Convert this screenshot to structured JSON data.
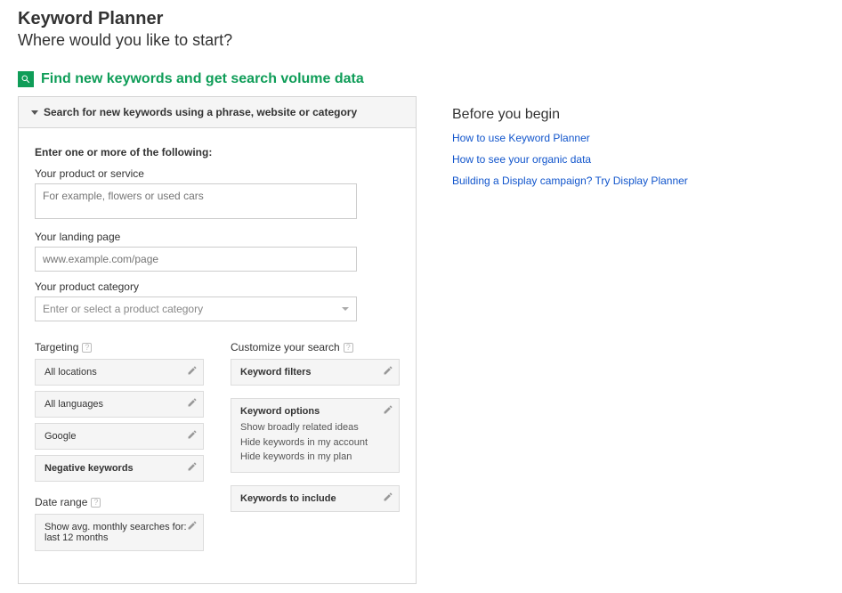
{
  "header": {
    "title": "Keyword Planner",
    "subtitle": "Where would you like to start?"
  },
  "section": {
    "title": "Find new keywords and get search volume data",
    "accordion_title": "Search for new keywords using a phrase, website or category"
  },
  "form": {
    "heading": "Enter one or more of the following:",
    "product_label": "Your product or service",
    "product_placeholder": "For example, flowers or used cars",
    "landing_label": "Your landing page",
    "landing_placeholder": "www.example.com/page",
    "category_label": "Your product category",
    "category_placeholder": "Enter or select a product category"
  },
  "targeting": {
    "heading": "Targeting",
    "locations": "All locations",
    "languages": "All languages",
    "network": "Google",
    "negative": "Negative keywords",
    "date_range_heading": "Date range",
    "date_range_value": "Show avg. monthly searches for: last 12 months"
  },
  "customize": {
    "heading": "Customize your search",
    "filters": "Keyword filters",
    "options_title": "Keyword options",
    "options_lines": [
      "Show broadly related ideas",
      "Hide keywords in my account",
      "Hide keywords in my plan"
    ],
    "include": "Keywords to include"
  },
  "sidebar": {
    "heading": "Before you begin",
    "links": [
      "How to use Keyword Planner",
      "How to see your organic data",
      "Building a Display campaign? Try Display Planner"
    ]
  }
}
